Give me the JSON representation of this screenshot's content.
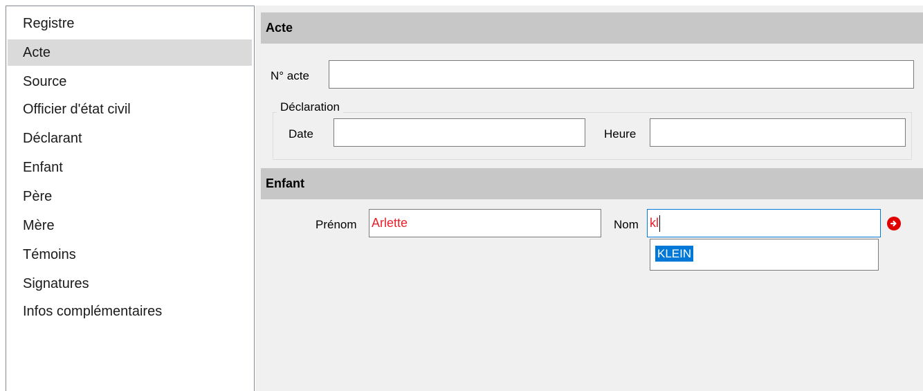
{
  "sidebar": {
    "items": [
      {
        "label": "Registre"
      },
      {
        "label": "Acte"
      },
      {
        "label": "Source"
      },
      {
        "label": "Officier d'état civil"
      },
      {
        "label": "Déclarant"
      },
      {
        "label": "Enfant"
      },
      {
        "label": "Père"
      },
      {
        "label": "Mère"
      },
      {
        "label": "Témoins"
      },
      {
        "label": "Signatures"
      },
      {
        "label": "Infos complémentaires"
      }
    ],
    "selected": "Acte"
  },
  "acte": {
    "title": "Acte",
    "numero_label": "N° acte",
    "numero_value": "",
    "declaration": {
      "title": "Déclaration",
      "date_label": "Date",
      "date_value": "",
      "heure_label": "Heure",
      "heure_value": ""
    }
  },
  "enfant": {
    "title": "Enfant",
    "prenom_label": "Prénom",
    "prenom_value": "Arlette",
    "nom_label": "Nom",
    "nom_value": "kl",
    "suggestions": [
      "KLEIN"
    ]
  },
  "colors": {
    "accent": "#0078d7",
    "required_text": "#e8202a",
    "header_bg": "#c7c7c7",
    "next_button": "#e00000"
  },
  "icons": {
    "next": "arrow-right-circle-icon"
  }
}
